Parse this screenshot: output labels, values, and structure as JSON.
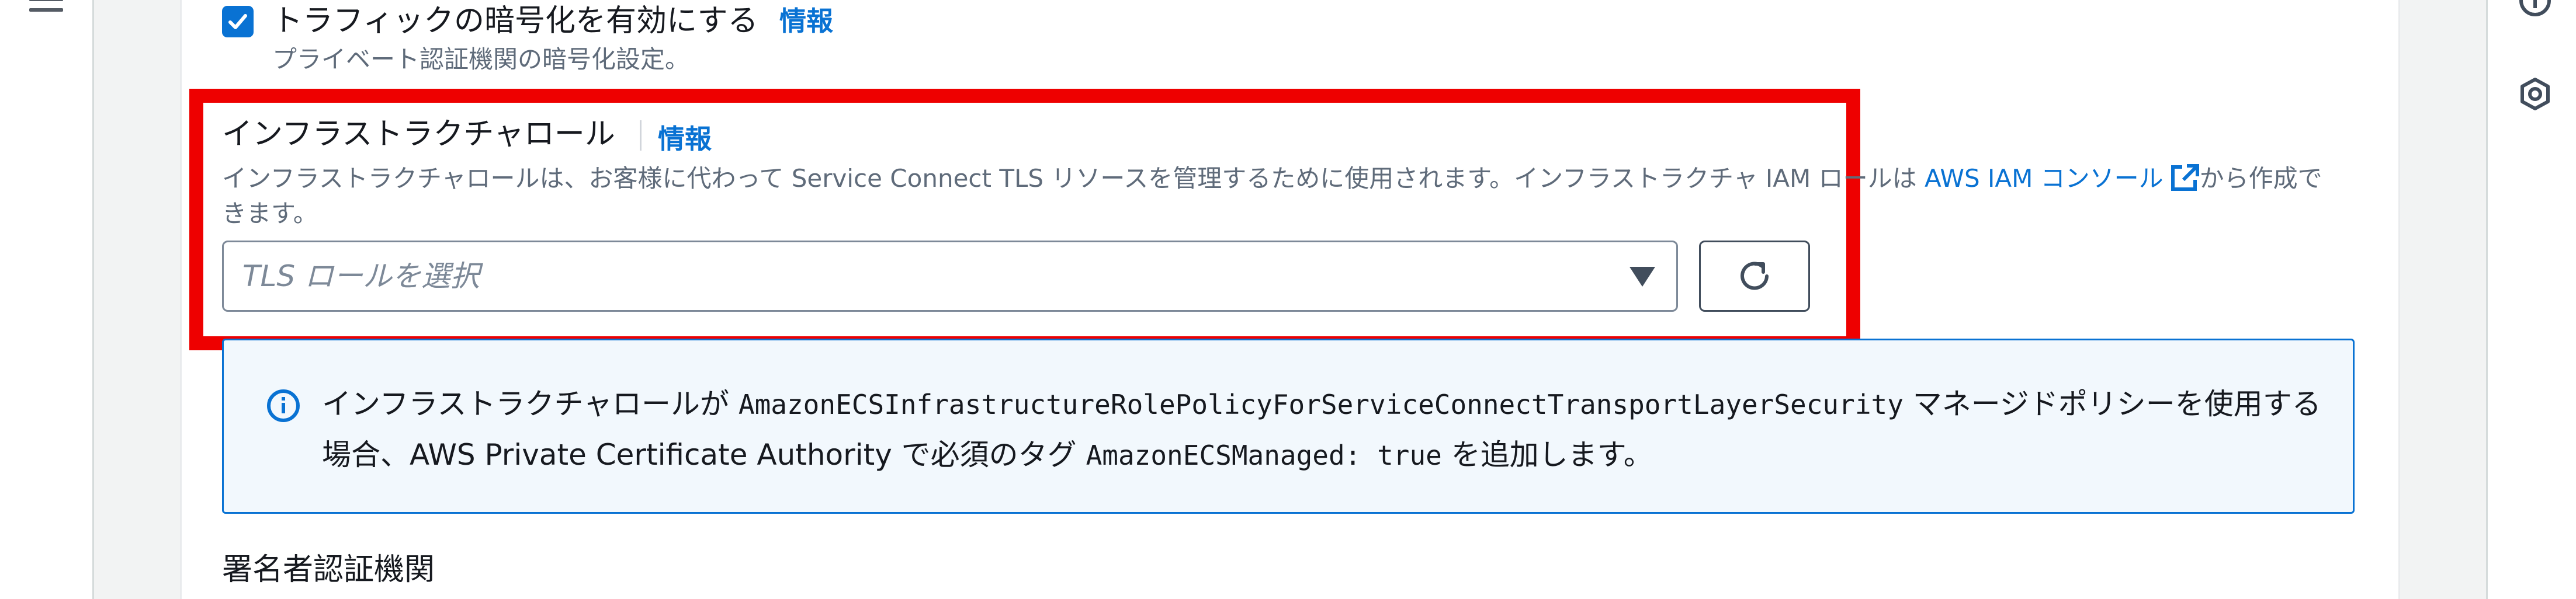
{
  "encryption": {
    "checkbox_label": "トラフィックの暗号化を有効にする",
    "info": "情報",
    "description": "プライベート認証機関の暗号化設定。"
  },
  "infrastructure_role": {
    "label": "インフラストラクチャロール",
    "info": "情報",
    "description_before": "インフラストラクチャロールは、お客様に代わって Service Connect TLS リソースを管理するために使用されます。インフラストラクチャ IAM ロールは ",
    "console_link": "AWS IAM コンソール",
    "description_after": "から作成できます。",
    "select_placeholder": "TLS ロールを選択"
  },
  "alert": {
    "text_1": "インフラストラクチャロールが ",
    "policy_code": "AmazonECSInfrastructureRolePolicyForServiceConnectTransportLayerSecurity",
    "text_2": " マネージドポリシーを使用する場合、AWS Private Certificate Authority で必須のタグ ",
    "tag_code": "AmazonECSManaged: true",
    "text_3": " を追加します。"
  },
  "signer": {
    "label": "署名者認証機関"
  },
  "colors": {
    "accent": "#0972d3",
    "highlight": "#ee0000",
    "alert_background": "#f2f8fd"
  },
  "icons": [
    "menu-icon",
    "info-circle-icon",
    "settings-icon",
    "external-link-icon",
    "refresh-icon",
    "caret-down-icon",
    "checkmark-icon"
  ]
}
